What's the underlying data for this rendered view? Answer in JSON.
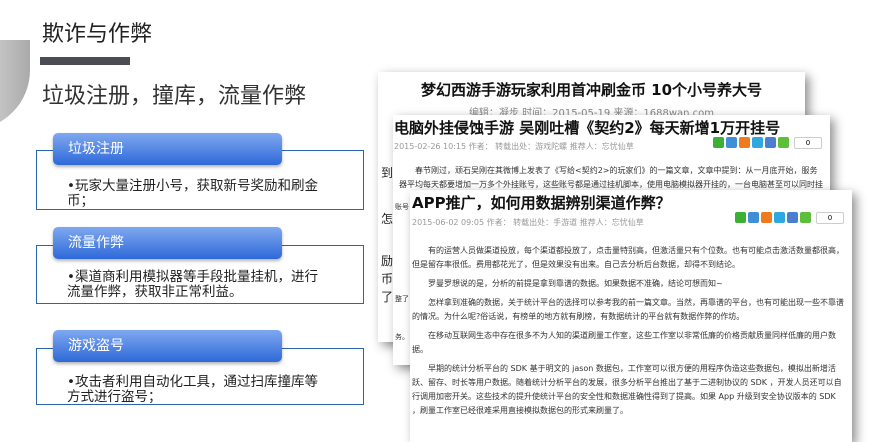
{
  "title": "欺诈与作弊",
  "subtitle": "垃圾注册，撞库，流量作弊",
  "sections": [
    {
      "label": "垃圾注册",
      "text": "•玩家大量注册小号，获取新号奖励和刷金币；"
    },
    {
      "label": "流量作弊",
      "text": "•渠道商利用模拟器等手段批量挂机，进行流量作弊，获取非正常利益。"
    },
    {
      "label": "游戏盗号",
      "text": "•攻击者利用自动化工具，通过扫库撞库等方式进行盗号；"
    }
  ],
  "articles": [
    {
      "headline": "梦幻西游手游玩家利用首冲刷金币 10个小号养大号",
      "meta": "编辑：凝步  时间：2015-05-19  来源：1688wan.com",
      "side": [
        "到",
        "怎",
        "励",
        "币",
        "了"
      ]
    },
    {
      "headline": "电脑外挂侵蚀手游 吴刚吐槽《契约2》每天新增1万开挂号",
      "meta": "2015-02-26 10:15 作者： 转载出处：游戏陀螺 推荐人：忘忧仙草",
      "count": "0",
      "body": "春节刚过，顽石吴刚在其微博上发表了《写给<契约2>的玩家们》的一篇文章，文章中提到：从一月底开始，服务器平均每天都要增加一万多个外挂账号，这些账号都是通过挂机脚本，使用电脑模拟器开挂的，一台电脑甚至可以同时挂数十个",
      "side": [
        "账号",
        "整了",
        "务。"
      ]
    },
    {
      "headline": "APP推广，如何用数据辨别渠道作弊？",
      "meta": "2015-06-02 09:05 作者： 转载出处：手游道 推荐人：忘忧仙草",
      "count": "0",
      "paragraphs": [
        "有的运营人员做渠道投放，每个渠道都投放了，点击量特别高，但激活量只有个位数。也有可能点击激活数量都很高，但是留存率很低。费用都花光了，但是效果没有出来。自己去分析后台数据，却得不到结论。",
        "罗曼罗想说的是，分析的前提是拿到靠谱的数据。如果数据不准确，结论可想而知~",
        "怎样拿到准确的数据，关于统计平台的选择可以参考我的前一篇文章。当然，再靠谱的平台，也有可能出现一些不靠谱的情况。为什么呢?俗话说，有榜单的地方就有刷榜，有数据统计的平台就有数据作弊的作坊。",
        "在移动互联网生态中存在很多不为人知的渠道刷量工作室，这些工作室以非常低廉的价格贡献质量同样低廉的用户数据。",
        "早期的统计分析平台的 SDK 基于明文的 jason 数据包，工作室可以很方便的用程序伪造这些数据包，模拟出新增活跃、留存、时长等用户数据。随着统计分析平台的发展，很多分析平台推出了基于二进制协议的 SDK ，开发人员还可以自行调用加密开关。这些技术的提升使统计平台的安全性和数据准确性得到了提高。如果 App 升级到安全协议版本的 SDK ，刷量工作室已经很难采用直接模拟数据包的形式来刷量了。"
      ]
    }
  ],
  "share_colors": [
    "#3cb034",
    "#3f8fd8",
    "#f07a1e",
    "#2fa7e0",
    "#4a7fd0",
    "#5cbf3a"
  ]
}
